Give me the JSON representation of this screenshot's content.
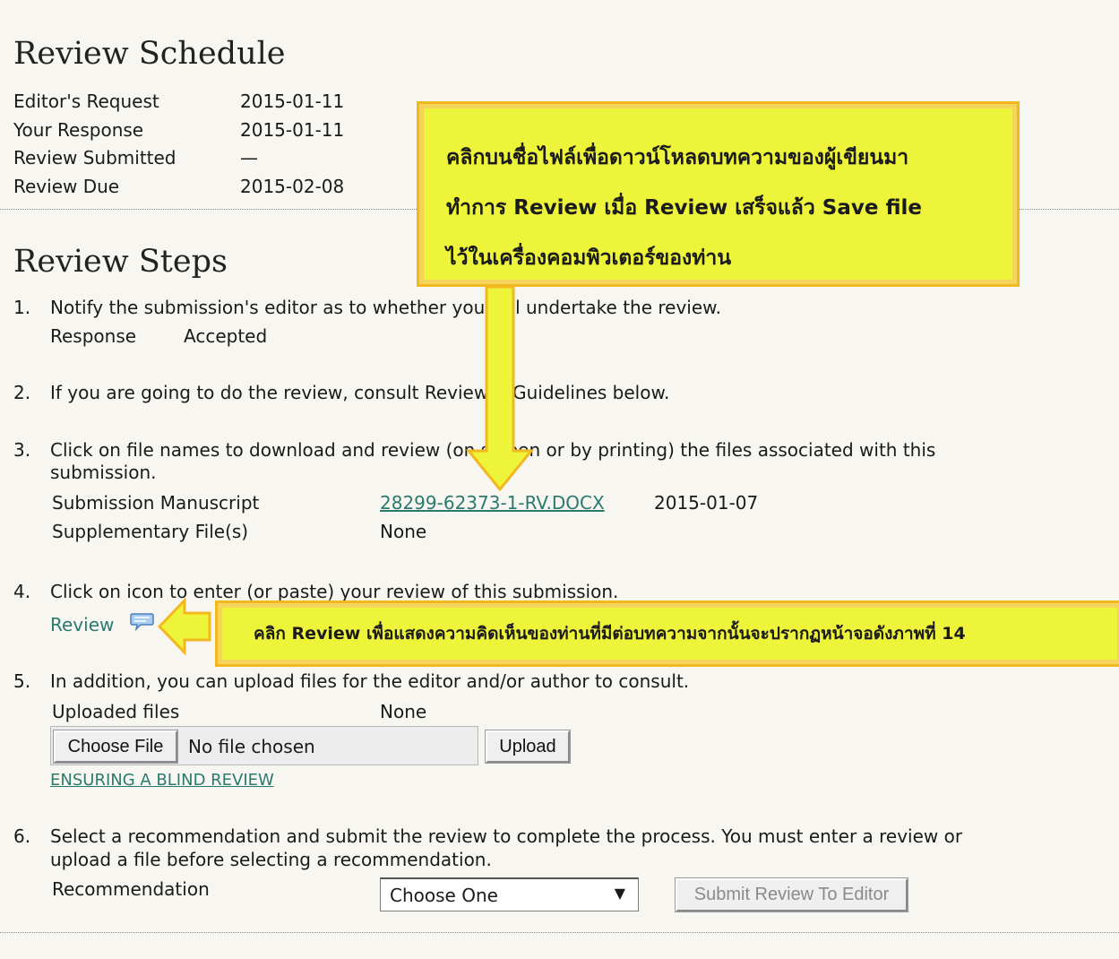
{
  "schedule": {
    "title": "Review Schedule",
    "rows": [
      {
        "label": "Editor's Request",
        "value": "2015-01-11"
      },
      {
        "label": "Your Response",
        "value": "2015-01-11"
      },
      {
        "label": "Review Submitted",
        "value": "—"
      },
      {
        "label": "Review Due",
        "value": "2015-02-08"
      }
    ]
  },
  "steps": {
    "title": "Review Steps",
    "s1": {
      "num": "1.",
      "text": "Notify the submission's editor as to whether you will undertake the review.",
      "response_label": "Response",
      "response_value": "Accepted"
    },
    "s2": {
      "num": "2.",
      "text": "If you are going to do the review, consult Reviewer Guidelines below."
    },
    "s3": {
      "num": "3.",
      "text_line1": "Click on file names to download and review (on screen or by printing) the files associated with this",
      "text_line2": "submission.",
      "manuscript_label": "Submission Manuscript",
      "manuscript_file": "28299-62373-1-RV.DOCX",
      "manuscript_date": "2015-01-07",
      "supp_label": "Supplementary File(s)",
      "supp_value": "None"
    },
    "s4": {
      "num": "4.",
      "text": "Click on icon to enter (or paste) your review of this submission.",
      "review_link": "Review"
    },
    "s5": {
      "num": "5.",
      "text": "In addition, you can upload files for the editor and/or author to consult.",
      "uploaded_label": "Uploaded files",
      "uploaded_value": "None",
      "choose_file": "Choose File",
      "no_file": "No file chosen",
      "upload": "Upload",
      "blind_link": "ENSURING A BLIND REVIEW"
    },
    "s6": {
      "num": "6.",
      "text_line1": "Select a recommendation and submit the review to complete the process. You must enter a review or",
      "text_line2": "upload a file before selecting a recommendation.",
      "rec_label": "Recommendation",
      "rec_selected": "Choose One",
      "submit": "Submit Review To Editor"
    }
  },
  "callouts": {
    "top_line1": "คลิกบนชื่อไฟล์เพื่อดาวน์โหลดบทความของผู้เขียนมา",
    "top_line2": "ทำการ Review เมื่อ Review เสร็จแล้ว Save file",
    "top_line3": "ไว้ในเครื่องคอมพิวเตอร์ของท่าน",
    "review": "คลิก Review เพื่อแสดงความคิดเห็นของท่านที่มีต่อบทความจากนั้นจะปรากฏหน้าจอดังภาพที่ 14"
  },
  "colors": {
    "callout_fill": "#eef43a",
    "callout_border": "#f2b81e",
    "link": "#2b7a6e"
  }
}
